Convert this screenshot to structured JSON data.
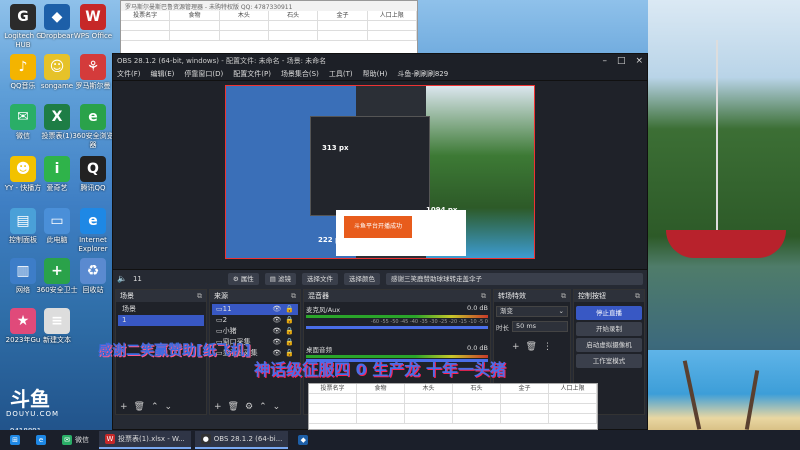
{
  "desktop": {
    "icons": [
      {
        "label": "Logitech G HUB",
        "color": "#2b2b2b",
        "glyph": "G"
      },
      {
        "label": "Dropbear",
        "color": "#1d5fa8",
        "glyph": "◆"
      },
      {
        "label": "WPS Office",
        "color": "#c62828",
        "glyph": "W"
      },
      {
        "label": "QQ音乐",
        "color": "#f4b400",
        "glyph": "♪"
      },
      {
        "label": "songame",
        "color": "#e6c229",
        "glyph": "☺"
      },
      {
        "label": "罗马斯尔曼",
        "color": "#d43b3b",
        "glyph": "⚘"
      },
      {
        "label": "微信",
        "color": "#2aae67",
        "glyph": "✉"
      },
      {
        "label": "投票表(1)",
        "color": "#1e7d45",
        "glyph": "X"
      },
      {
        "label": "360安全浏览器",
        "color": "#2aa24a",
        "glyph": "e"
      },
      {
        "label": "YY - 快播方",
        "color": "#f2c200",
        "glyph": "☻"
      },
      {
        "label": "爱奇艺",
        "color": "#2fb34a",
        "glyph": "i"
      },
      {
        "label": "腾讯QQ",
        "color": "#222222",
        "glyph": "Q"
      },
      {
        "label": "控制面板",
        "color": "#4aa0d8",
        "glyph": "▤"
      },
      {
        "label": "此电脑",
        "color": "#4a8fd8",
        "glyph": "▭"
      },
      {
        "label": "Internet Explorer",
        "color": "#1e88e5",
        "glyph": "e"
      },
      {
        "label": "网络",
        "color": "#3d7dc8",
        "glyph": "▥"
      },
      {
        "label": "360安全卫士",
        "color": "#2aa24a",
        "glyph": "+"
      },
      {
        "label": "回收站",
        "color": "#5a8ad0",
        "glyph": "♻"
      },
      {
        "label": "2023年Gu",
        "color": "#e04a7a",
        "glyph": "★"
      },
      {
        "label": "新建文本",
        "color": "#dddddd",
        "glyph": "≡"
      }
    ]
  },
  "excel_top": {
    "title": "罗马斯尔曼斯巴鲁资源管理器 - 未购特权版 QQ: 4787330911",
    "headers": [
      "投票名字",
      "食物",
      "木头",
      "石头",
      "金子",
      "人口上限"
    ]
  },
  "obs": {
    "title": "OBS 28.1.2 (64-bit, windows) - 配置文件: 未命名 - 场景: 未命名",
    "menu": [
      "文件(F)",
      "编辑(E)",
      "停靠窗口(D)",
      "配置文件(P)",
      "场景集合(S)",
      "工具(T)",
      "帮助(H)",
      "斗鱼-刷刷刷829"
    ],
    "preview_labels": {
      "px1": "313 px",
      "px2": "1094 px",
      "px3": "222 px",
      "orange_text": "斗鱼平台开播成功"
    },
    "toolbar": {
      "source_name": "11",
      "properties": "属性",
      "filters": "滤镜",
      "select_file": "选择文件",
      "select_color": "选择颜色",
      "thanks": "感谢三笑鹿赞助球球转走盖伞子"
    },
    "scenes": {
      "title": "场景",
      "items": [
        "场景",
        "1"
      ]
    },
    "sources": {
      "title": "来源",
      "items": [
        "11",
        "2",
        "小猪",
        "窗口采集",
        "显示器采集"
      ]
    },
    "mixer": {
      "title": "混音器",
      "channels": [
        {
          "name": "麦克风/Aux",
          "db": "0.0 dB"
        },
        {
          "name": "桌面音频",
          "db": "0.0 dB"
        }
      ],
      "scale": "-60 -55 -50 -45 -40 -35 -30 -25 -20 -15 -10 -5 0"
    },
    "transitions": {
      "title": "转场特效",
      "type": "渐变",
      "duration_label": "时长",
      "duration": "50 ms"
    },
    "controls": {
      "title": "控制按钮",
      "stop_stream": "停止直播",
      "start_record": "开始录制",
      "virtual_cam": "启动虚拟摄像机",
      "studio": "工作室模式"
    }
  },
  "excel_bottom": {
    "headers": [
      "投票名字",
      "食物",
      "木头",
      "石头",
      "金子",
      "人口上限"
    ]
  },
  "overlay": {
    "banner1": "感谢二笑赢赞助[纸飞机]",
    "banner2": "神话级征服四 0 生产龙 十年一头猪"
  },
  "brand": {
    "mark": "斗鱼",
    "word": "DOUYU.COM",
    "room_id": "9418891"
  },
  "taskbar": {
    "items": [
      {
        "label": "",
        "icon": "⊞"
      },
      {
        "label": "",
        "icon": "e"
      },
      {
        "label": "微信",
        "icon": "✉"
      },
      {
        "label": "投票表(1).xlsx - W...",
        "icon": "W"
      },
      {
        "label": "OBS 28.1.2 (64-bi...",
        "icon": "●"
      },
      {
        "label": "",
        "icon": "◆"
      }
    ]
  }
}
